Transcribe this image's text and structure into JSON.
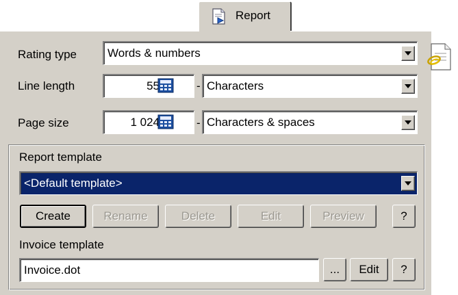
{
  "tab": {
    "label": "Report",
    "icon": "report-document-icon"
  },
  "rating": {
    "label": "Rating type",
    "value": "Words & numbers"
  },
  "line_length": {
    "label": "Line length",
    "value": "55",
    "separator": "-",
    "unit": "Characters"
  },
  "page_size": {
    "label": "Page size",
    "value": "1 024",
    "separator": "-",
    "unit": "Characters & spaces"
  },
  "report_template": {
    "label": "Report template",
    "value": "<Default template>",
    "buttons": {
      "create": "Create",
      "rename": "Rename",
      "delete": "Delete",
      "edit": "Edit",
      "preview": "Preview",
      "help": "?"
    }
  },
  "invoice_template": {
    "label": "Invoice template",
    "value": "Invoice.dot",
    "buttons": {
      "browse": "...",
      "edit": "Edit",
      "help": "?"
    }
  },
  "colors": {
    "panel": "#d4d0c8",
    "selection": "#0a246a"
  }
}
